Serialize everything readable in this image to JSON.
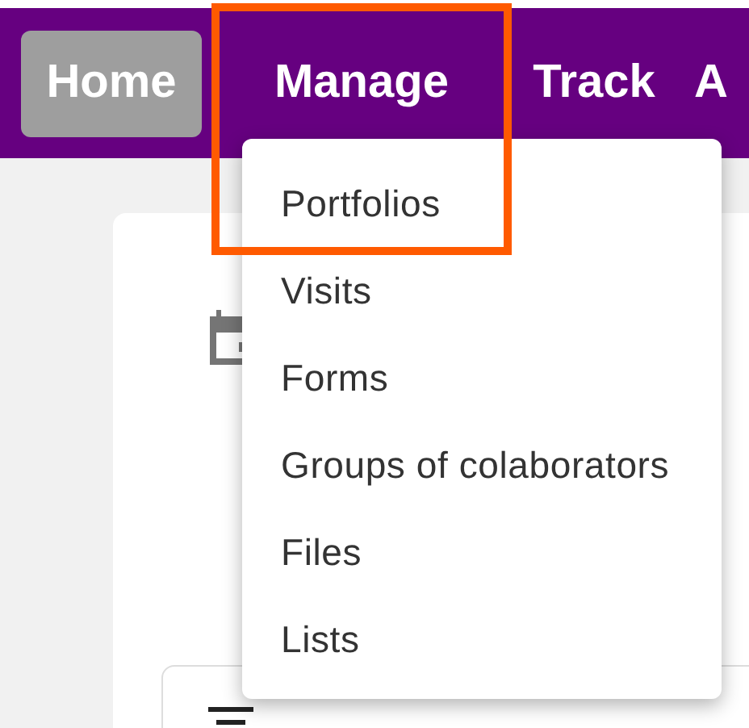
{
  "nav": {
    "items": [
      {
        "label": "Home",
        "selected": true,
        "highlighted": false
      },
      {
        "label": "Manage",
        "selected": false,
        "highlighted": true
      },
      {
        "label": "Track",
        "selected": false,
        "highlighted": false
      },
      {
        "label": "A",
        "selected": false,
        "highlighted": false
      }
    ]
  },
  "dropdown_menu": {
    "items": [
      "Portfolios",
      "Visits",
      "Forms",
      "Groups of colaborators",
      "Files",
      "Lists"
    ]
  }
}
